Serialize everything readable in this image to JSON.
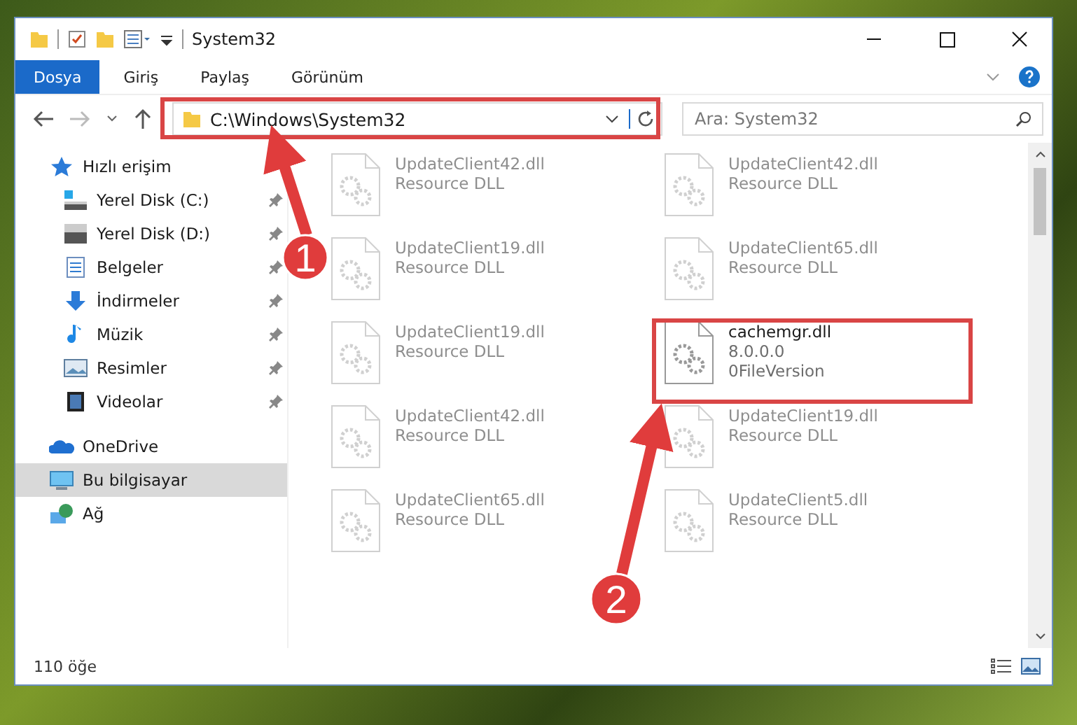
{
  "window": {
    "title": "System32"
  },
  "ribbon": {
    "tabs": [
      {
        "label": "Dosya",
        "selected": true
      },
      {
        "label": "Giriş",
        "selected": false
      },
      {
        "label": "Paylaş",
        "selected": false
      },
      {
        "label": "Görünüm",
        "selected": false
      }
    ]
  },
  "address": {
    "path": "C:\\Windows\\System32"
  },
  "search": {
    "placeholder": "Ara: System32"
  },
  "sidebar": {
    "items": [
      {
        "label": "Hızlı erişim",
        "kind": "star",
        "selected": false,
        "children": [
          {
            "label": "Yerel Disk (C:)",
            "kind": "drive-c",
            "pinned": true,
            "selected": false
          },
          {
            "label": "Yerel Disk (D:)",
            "kind": "drive",
            "pinned": true,
            "selected": false
          },
          {
            "label": "Belgeler",
            "kind": "document",
            "pinned": true,
            "selected": false
          },
          {
            "label": "İndirmeler",
            "kind": "download",
            "pinned": true,
            "selected": false
          },
          {
            "label": "Müzik",
            "kind": "music",
            "pinned": true,
            "selected": false
          },
          {
            "label": "Resimler",
            "kind": "picture",
            "pinned": true,
            "selected": false
          },
          {
            "label": "Videolar",
            "kind": "video",
            "pinned": true,
            "selected": false
          }
        ]
      },
      {
        "label": "OneDrive",
        "kind": "cloud",
        "selected": false
      },
      {
        "label": "Bu bilgisayar",
        "kind": "computer",
        "selected": true
      },
      {
        "label": "Ağ",
        "kind": "network",
        "selected": false
      }
    ]
  },
  "files": [
    {
      "name": "UpdateClient42.dll",
      "details": [
        "Resource DLL"
      ],
      "kind": "faded"
    },
    {
      "name": "UpdateClient42.dll",
      "details": [
        "Resource DLL"
      ],
      "kind": "faded"
    },
    {
      "name": "UpdateClient19.dll",
      "details": [
        "Resource DLL"
      ],
      "kind": "faded"
    },
    {
      "name": "UpdateClient65.dll",
      "details": [
        "Resource DLL"
      ],
      "kind": "faded"
    },
    {
      "name": "UpdateClient19.dll",
      "details": [
        "Resource DLL"
      ],
      "kind": "faded"
    },
    {
      "name": "cachemgr.dll",
      "details": [
        "8.0.0.0",
        "0FileVersion"
      ],
      "kind": "highlighted"
    },
    {
      "name": "UpdateClient42.dll",
      "details": [
        "Resource DLL"
      ],
      "kind": "faded"
    },
    {
      "name": "UpdateClient19.dll",
      "details": [
        "Resource DLL"
      ],
      "kind": "faded"
    },
    {
      "name": "UpdateClient65.dll",
      "details": [
        "Resource DLL"
      ],
      "kind": "faded"
    },
    {
      "name": "UpdateClient5.dll",
      "details": [
        "Resource DLL"
      ],
      "kind": "faded"
    }
  ],
  "status_bar": {
    "count": "110 öğe"
  },
  "annotations": [
    {
      "number": "1"
    },
    {
      "number": "2"
    }
  ]
}
